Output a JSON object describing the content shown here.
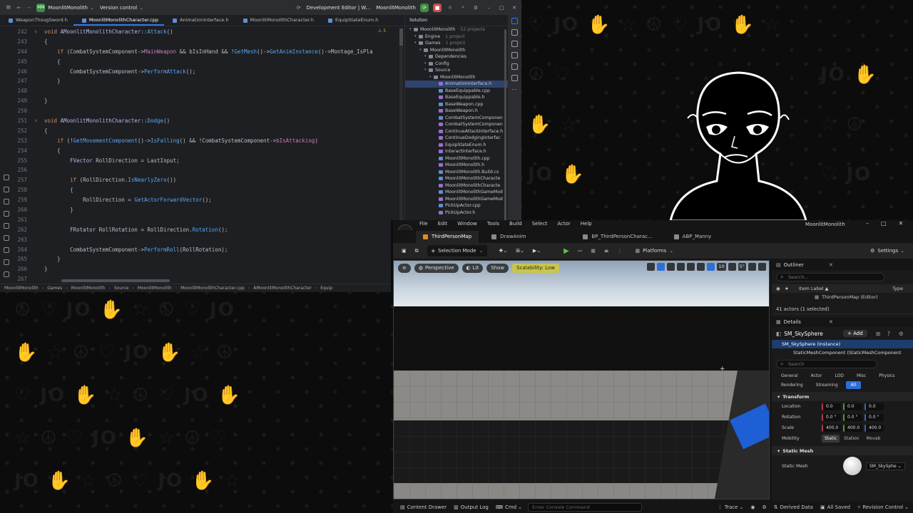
{
  "ide": {
    "project": "MoonlitMonolith",
    "project_badge": "MM",
    "version_control": "Version control",
    "run_config": "Development Editor | W...",
    "run_target": "MoonlitMonolith",
    "tabs": [
      {
        "label": "WeaponThougSword.h",
        "active": false
      },
      {
        "label": "MoonlitMonolithCharacter.cpp",
        "active": true
      },
      {
        "label": "AnimationInterface.h",
        "active": false
      },
      {
        "label": "MoonlitMonolithCharacter.h",
        "active": false
      },
      {
        "label": "EquipStateEnum.h",
        "active": false
      }
    ],
    "warning_count": "5",
    "breadcrumb": [
      "MoonlitMonolith",
      "Games",
      "MoonlitMonolith",
      "Source",
      "MoonlitMonolith",
      "MoonlitMonolithCharacter.cpp",
      "AMoonlitMonolithCharacter",
      "Equip"
    ],
    "code_lines": [
      {
        "n": "242",
        "t": "void AMoonlitMonolithCharacter::Attack()"
      },
      {
        "n": "243",
        "t": "{"
      },
      {
        "n": "244",
        "t": "    if (CombatSystemComponent->MainWeapon && bIsInHand && !GetMesh()->GetAnimInstance()->Montage_IsPla"
      },
      {
        "n": "245",
        "t": "    {"
      },
      {
        "n": "246",
        "t": "        CombatSystemComponent->PerformAttack();"
      },
      {
        "n": "247",
        "t": "    }"
      },
      {
        "n": "248",
        "t": ""
      },
      {
        "n": "249",
        "t": "}"
      },
      {
        "n": "250",
        "t": ""
      },
      {
        "n": "251",
        "t": "void AMoonlitMonolithCharacter::Dodge()"
      },
      {
        "n": "252",
        "t": "{"
      },
      {
        "n": "253",
        "t": "    if (!GetMovementComponent()->IsFalling() && !CombatSystemComponent->bIsAttacking)"
      },
      {
        "n": "254",
        "t": "    {"
      },
      {
        "n": "255",
        "t": "        FVector RollDirection = LastInput;"
      },
      {
        "n": "256",
        "t": ""
      },
      {
        "n": "257",
        "t": "        if (RollDirection.IsNearlyZero())"
      },
      {
        "n": "258",
        "t": "        {"
      },
      {
        "n": "259",
        "t": "            RollDirection = GetActorForwardVector();"
      },
      {
        "n": "260",
        "t": "        }"
      },
      {
        "n": "261",
        "t": ""
      },
      {
        "n": "262",
        "t": "        FRotator RollRotation = RollDirection.Rotation();"
      },
      {
        "n": "263",
        "t": ""
      },
      {
        "n": "264",
        "t": "        CombatSystemComponent->PerformRoll(RollRotation);"
      },
      {
        "n": "265",
        "t": "    }"
      },
      {
        "n": "266",
        "t": "}"
      },
      {
        "n": "267",
        "t": ""
      }
    ],
    "solution": {
      "header": "Solution",
      "rows": [
        {
          "label": "MoonlitMonolith",
          "sub": "· 52 projects",
          "indent": 0,
          "kind": "folder"
        },
        {
          "label": "Engine",
          "sub": "· 1 project",
          "indent": 1,
          "kind": "folder"
        },
        {
          "label": "Games",
          "sub": "· 1 project",
          "indent": 1,
          "kind": "folder"
        },
        {
          "label": "MoonlitMonolith",
          "sub": "",
          "indent": 2,
          "kind": "folder"
        },
        {
          "label": "Dependencies",
          "sub": "",
          "indent": 3,
          "kind": "folder"
        },
        {
          "label": "Config",
          "sub": "",
          "indent": 3,
          "kind": "folder"
        },
        {
          "label": "Source",
          "sub": "",
          "indent": 3,
          "kind": "folder"
        },
        {
          "label": "MoonlitMonolith",
          "sub": "",
          "indent": 4,
          "kind": "folder"
        },
        {
          "label": "AnimationInterface.h",
          "sub": "",
          "indent": 5,
          "kind": "hfile",
          "selected": true
        },
        {
          "label": "BaseEquippable.cpp",
          "sub": "",
          "indent": 5,
          "kind": "file"
        },
        {
          "label": "BaseEquippable.h",
          "sub": "",
          "indent": 5,
          "kind": "hfile"
        },
        {
          "label": "BaseWeapon.cpp",
          "sub": "",
          "indent": 5,
          "kind": "file"
        },
        {
          "label": "BaseWeapon.h",
          "sub": "",
          "indent": 5,
          "kind": "hfile"
        },
        {
          "label": "CombatSystemComponen",
          "sub": "",
          "indent": 5,
          "kind": "file"
        },
        {
          "label": "CombatSystemComponen",
          "sub": "",
          "indent": 5,
          "kind": "hfile"
        },
        {
          "label": "ContinueAttackInterface.h",
          "sub": "",
          "indent": 5,
          "kind": "hfile"
        },
        {
          "label": "ContinueDodgingInterfac",
          "sub": "",
          "indent": 5,
          "kind": "hfile"
        },
        {
          "label": "EquipStateEnum.h",
          "sub": "",
          "indent": 5,
          "kind": "hfile"
        },
        {
          "label": "InteractInterface.h",
          "sub": "",
          "indent": 5,
          "kind": "hfile"
        },
        {
          "label": "MoonlitMonolith.cpp",
          "sub": "",
          "indent": 5,
          "kind": "file"
        },
        {
          "label": "MoonlitMonolith.h",
          "sub": "",
          "indent": 5,
          "kind": "hfile"
        },
        {
          "label": "MoonlitMonolith.Build.cs",
          "sub": "",
          "indent": 5,
          "kind": "file"
        },
        {
          "label": "MoonlitMonolithCharacte",
          "sub": "",
          "indent": 5,
          "kind": "file"
        },
        {
          "label": "MoonlitMonolithCharacte",
          "sub": "",
          "indent": 5,
          "kind": "hfile"
        },
        {
          "label": "MoonlitMonolithGameMod",
          "sub": "",
          "indent": 5,
          "kind": "file"
        },
        {
          "label": "MoonlitMonolithGameMod",
          "sub": "",
          "indent": 5,
          "kind": "hfile"
        },
        {
          "label": "PickUpActor.cpp",
          "sub": "",
          "indent": 5,
          "kind": "file"
        },
        {
          "label": "PickUpActor.h",
          "sub": "",
          "indent": 5,
          "kind": "hfile"
        }
      ]
    }
  },
  "ue": {
    "menus": [
      "File",
      "Edit",
      "Window",
      "Tools",
      "Build",
      "Select",
      "Actor",
      "Help"
    ],
    "window_title": "MoonlitMonolith",
    "doc_tabs": [
      {
        "label": "ThirdPersonMap",
        "active": true
      },
      {
        "label": "DrawAnim",
        "active": false
      },
      {
        "label": "BP_ThirdPersonCharac...",
        "active": false
      },
      {
        "label": "ABP_Manny",
        "active": false
      }
    ],
    "toolbar": {
      "selection_mode": "Selection Mode",
      "platforms": "Platforms",
      "settings": "Settings"
    },
    "viewport": {
      "perspective": "Perspective",
      "lit": "Lit",
      "show": "Show",
      "scalability": "Scalability: Low",
      "grid_size": "10",
      "angle": "5°"
    },
    "outliner": {
      "title": "Outliner",
      "search_placeholder": "Search...",
      "col_label": "Item Label ▲",
      "col_type": "Type",
      "rows": [
        "ThirdPersonMap (Editor)"
      ],
      "count": "41 actors (1 selected)"
    },
    "details": {
      "title": "Details",
      "object": "SM_SkySphere",
      "add_label": "+ Add",
      "instance": "SM_SkySphere (Instance)",
      "component": "StaticMeshComponent (StaticMeshComponent",
      "search_placeholder": "Search",
      "filters": [
        {
          "label": "General",
          "on": false
        },
        {
          "label": "Actor",
          "on": false
        },
        {
          "label": "LOD",
          "on": false
        },
        {
          "label": "Misc",
          "on": false
        },
        {
          "label": "Physics",
          "on": false
        },
        {
          "label": "Rendering",
          "on": false
        },
        {
          "label": "Streaming",
          "on": false
        },
        {
          "label": "All",
          "on": true
        }
      ],
      "transform_title": "Transform",
      "location_label": "Location",
      "location": [
        "0.0",
        "0.0",
        "0.0"
      ],
      "rotation_label": "Rotation",
      "rotation": [
        "0.0 °",
        "0.0 °",
        "0.0 °"
      ],
      "scale_label": "Scale",
      "scale": [
        "400.0",
        "400.0",
        "400.0"
      ],
      "mobility_label": "Mobility",
      "mobility_options": [
        {
          "label": "Static",
          "on": true
        },
        {
          "label": "Station",
          "on": false
        },
        {
          "label": "Movab",
          "on": false
        }
      ],
      "static_mesh_title": "Static Mesh",
      "static_mesh_label": "Static Mesh",
      "static_mesh_value": "SM_SkySphe"
    },
    "statusbar": {
      "content_drawer": "Content Drawer",
      "output_log": "Output Log",
      "cmd": "Cmd",
      "console_placeholder": "Enter Console Command",
      "trace": "Trace",
      "derived_data": "Derived Data",
      "all_saved": "All Saved",
      "revision_control": "Revision Control"
    }
  },
  "colors": {
    "ide_bg": "#1e1f22",
    "accent_blue": "#3574f0",
    "ue_bg": "#151515",
    "play_green": "#5fbf4a",
    "scalability_yellow": "#c9c64a",
    "selection_blue": "#1d3d6e"
  }
}
